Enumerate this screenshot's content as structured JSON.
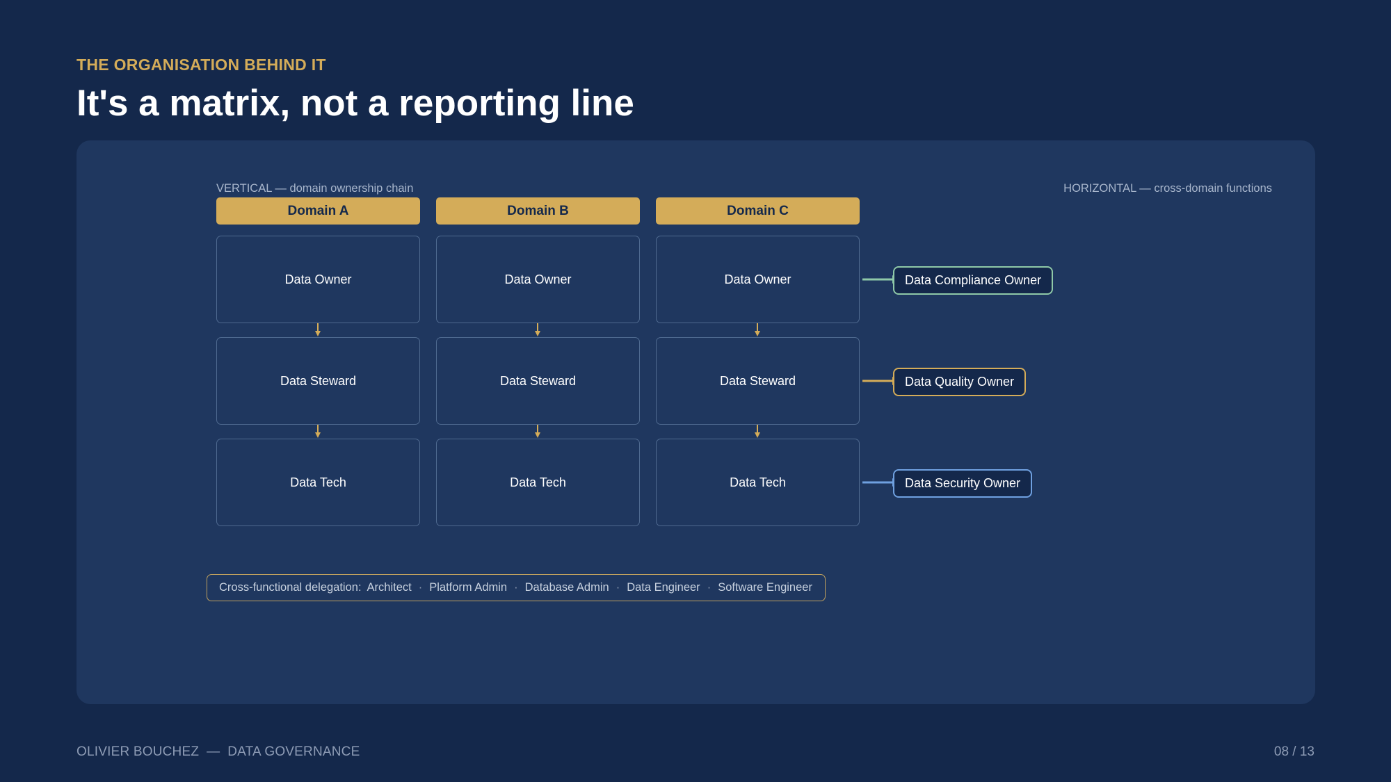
{
  "header": {
    "eyebrow": "THE ORGANISATION BEHIND IT",
    "title": "It's a matrix, not a reporting line"
  },
  "captions": {
    "vertical": "VERTICAL — domain ownership chain",
    "horizontal": "HORIZONTAL — cross-domain functions"
  },
  "domains": [
    {
      "name": "Domain A",
      "roles": [
        "Data Owner",
        "Data Steward",
        "Data Tech"
      ]
    },
    {
      "name": "Domain B",
      "roles": [
        "Data Owner",
        "Data Steward",
        "Data Tech"
      ]
    },
    {
      "name": "Domain C",
      "roles": [
        "Data Owner",
        "Data Steward",
        "Data Tech"
      ]
    }
  ],
  "functions": [
    {
      "label": "Data Compliance Owner",
      "color": "#8fc9a8"
    },
    {
      "label": "Data Quality Owner",
      "color": "#d4ac59"
    },
    {
      "label": "Data Security Owner",
      "color": "#6fa0e0"
    }
  ],
  "accent_color": "#d4ac59",
  "delegation": {
    "lead": "Cross-functional delegation:",
    "items": [
      "Architect",
      "Platform Admin",
      "Database Admin",
      "Data Engineer",
      "Software Engineer"
    ],
    "separator": "·"
  },
  "footer": {
    "author": "OLIVIER BOUCHEZ  —  DATA GOVERNANCE",
    "page": "08 / 13"
  }
}
